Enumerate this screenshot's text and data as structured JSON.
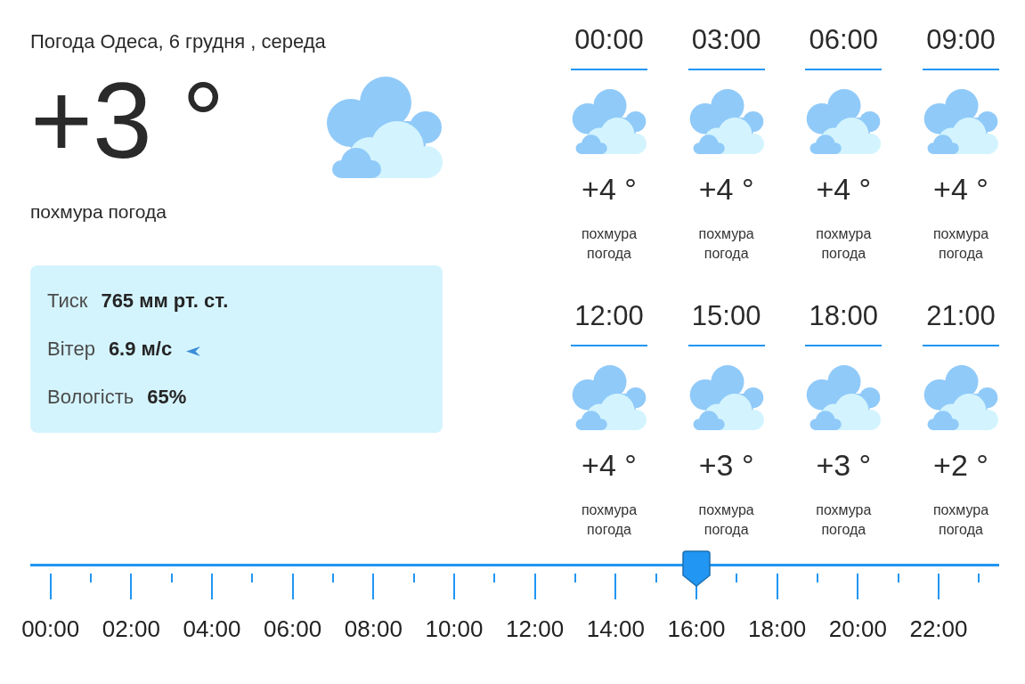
{
  "header": {
    "title": "Погода Одеса, 6 грудня , середа"
  },
  "current": {
    "temperature": "+3 °",
    "description": "похмура погода"
  },
  "details": [
    {
      "kind": "pressure",
      "label": "Тиск",
      "value": "765 мм рт. ст."
    },
    {
      "kind": "wind",
      "label": "Вітер",
      "value": "6.9 м/с"
    },
    {
      "kind": "humidity",
      "label": "Вологість",
      "value": "65%"
    }
  ],
  "hourly": [
    {
      "time": "00:00",
      "temperature": "+4 °",
      "description": "похмура погода"
    },
    {
      "time": "03:00",
      "temperature": "+4 °",
      "description": "похмура погода"
    },
    {
      "time": "06:00",
      "temperature": "+4 °",
      "description": "похмура погода"
    },
    {
      "time": "09:00",
      "temperature": "+4 °",
      "description": "похмура погода"
    },
    {
      "time": "12:00",
      "temperature": "+4 °",
      "description": "похмура погода"
    },
    {
      "time": "15:00",
      "temperature": "+3 °",
      "description": "похмура погода"
    },
    {
      "time": "18:00",
      "temperature": "+3 °",
      "description": "похмура погода"
    },
    {
      "time": "21:00",
      "temperature": "+2 °",
      "description": "похмура погода"
    }
  ],
  "timeline": {
    "labels": [
      "00:00",
      "02:00",
      "04:00",
      "06:00",
      "08:00",
      "10:00",
      "12:00",
      "14:00",
      "16:00",
      "18:00",
      "20:00",
      "22:00"
    ],
    "level": 0.6875
  }
}
